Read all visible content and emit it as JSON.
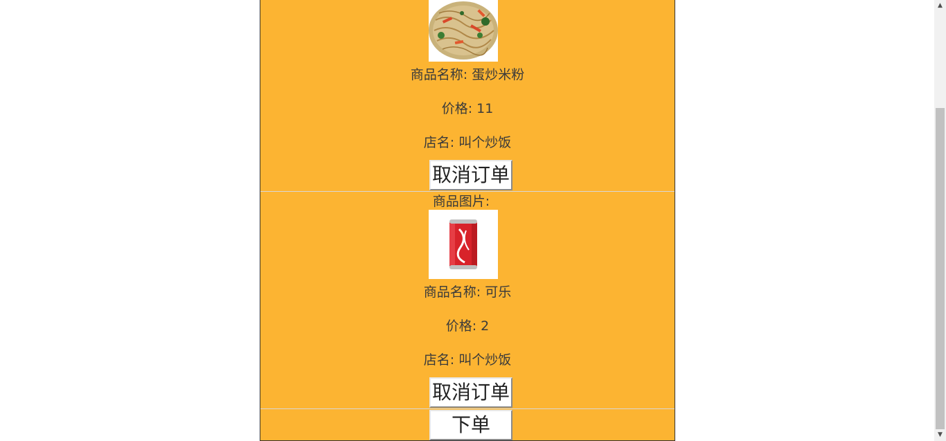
{
  "orders": [
    {
      "image_label": "",
      "image_icon": "fried-rice-noodles-photo",
      "name_text": "商品名称: 蛋炒米粉",
      "price_text": "价格: 11",
      "shop_text": "店名: 叫个炒饭",
      "cancel_label": "取消订单"
    },
    {
      "image_label": "商品图片:",
      "image_icon": "cola-can-photo",
      "name_text": "商品名称: 可乐",
      "price_text": "价格: 2",
      "shop_text": "店名: 叫个炒饭",
      "cancel_label": "取消订单"
    }
  ],
  "place_order_label": "下单",
  "colors": {
    "panel_bg": "#fcb432",
    "text": "#3a3a3a"
  },
  "scrollbar": {
    "up_icon": "scroll-up-arrow-icon",
    "down_icon": "scroll-down-arrow-icon"
  }
}
